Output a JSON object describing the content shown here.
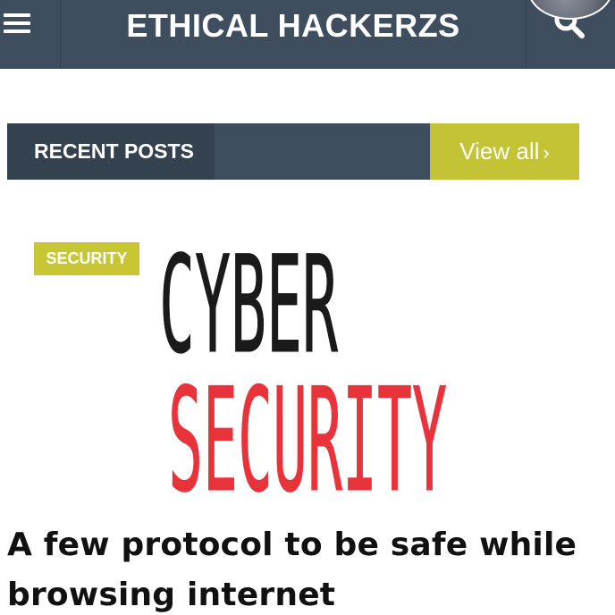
{
  "header": {
    "site_title": "ETHICAL HACKERZS",
    "menu_icon": "hamburger-menu-icon",
    "search_icon": "search-icon",
    "bar_color": "#3f4e5e"
  },
  "recent_posts": {
    "label": "RECENT POSTS",
    "view_all_label": "View all",
    "view_all_chevron": "›",
    "accent_color": "#c4c235"
  },
  "post": {
    "category": "SECURITY",
    "image_line1": "CYBER",
    "image_line2": "SECURITY",
    "image_color1": "#1a1a1a",
    "image_color2": "#e8333a",
    "title": "A few protocol to be safe while browsing internet"
  }
}
